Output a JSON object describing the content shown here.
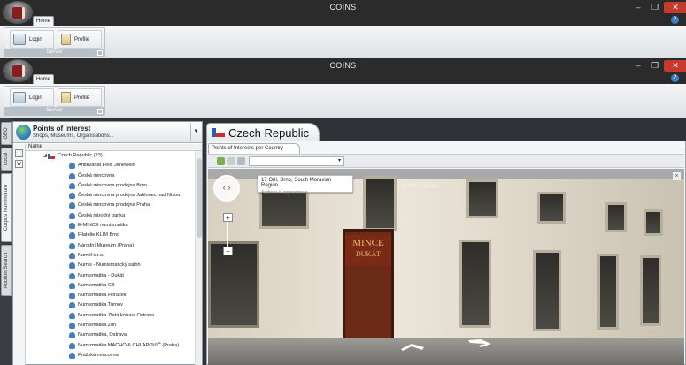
{
  "app": {
    "title": "COINS"
  },
  "window_controls": {
    "minimize": "–",
    "restore": "❐",
    "close": "✕"
  },
  "ribbon": {
    "tab_home": "Home",
    "group_server": {
      "label": "Server",
      "login_label": "Login",
      "profile_label": "Profile"
    },
    "help": "?"
  },
  "vertical_tabs": [
    "GEO",
    "Local",
    "Corpus Nummorum",
    "Auction Search"
  ],
  "poi": {
    "title": "Points of Interest",
    "subtitle": "Shops, Museums, Organisations...",
    "column_name": "Name",
    "side_buttons": [
      "",
      "W"
    ],
    "root": "Czech Republic (23)",
    "items": [
      "Antikvariát Felix Jenewein",
      "Česká mincovna",
      "Česká mincovna prodejna Brno",
      "Česká mincovna prodejna Jablonec nad Nisou",
      "Česká mincovna prodejna Praha",
      "Česká národní banka",
      "E-MINCE numismatika",
      "Filatelie KLIM Brno",
      "Národní Muzeum (Praha)",
      "Numfil s.r.o.",
      "Numis - Numismatický salon",
      "Numismatika - Dukát",
      "Numismatika CB",
      "Numismatika Horáček",
      "Numismatika Turnov",
      "Numismatika Zlatá koruna Ostrava",
      "Numismatika Zlín",
      "Numismatika, Ostrava",
      "Numizmatika MACHO & CHLAPOVIČ (Praha)",
      "Pražská mincovna"
    ]
  },
  "country": {
    "title": "Czech Republic",
    "subtab": "Points of Interests per Country",
    "popup_line1": "17 Orlí, Brno, South Moravian Region",
    "popup_line2": "Address is approximate",
    "watermark": "© 2013 Google",
    "sign_top": "MINCE",
    "sign_bottom": "DUKÁT",
    "zoom_in": "+",
    "zoom_out": "−",
    "close": "×"
  }
}
